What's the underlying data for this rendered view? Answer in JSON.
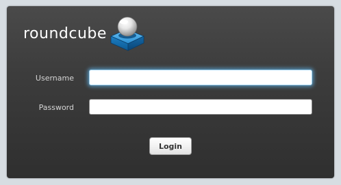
{
  "brand": {
    "name": "roundcube",
    "icon": "roundcube-logo-icon"
  },
  "form": {
    "username_label": "Username",
    "username_value": "",
    "password_label": "Password",
    "password_value": "",
    "submit_label": "Login"
  },
  "colors": {
    "page_background": "#d7dde2",
    "panel_background": "#3a3a3a",
    "focus_glow": "#5fafe1",
    "logo_blue": "#1b7fc3"
  }
}
